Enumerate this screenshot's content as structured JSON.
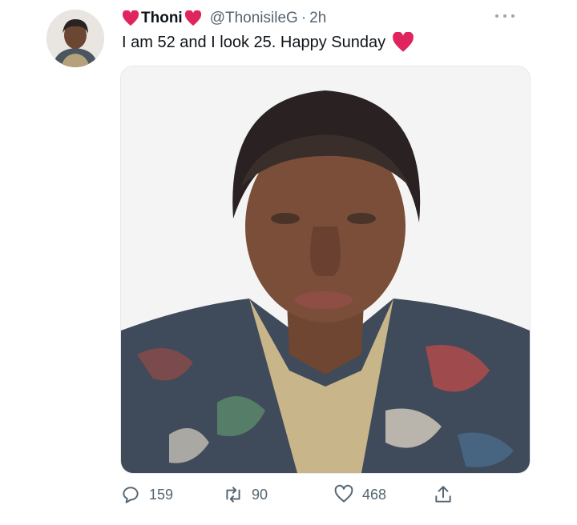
{
  "tweet": {
    "display_name": "Thoni",
    "handle": "@ThonisileG",
    "separator": "·",
    "time": "2h",
    "text": "I am 52 and I look 25. Happy Sunday"
  },
  "icons": {
    "name_left": "red-heart-icon",
    "name_right": "red-heart-icon",
    "text_end": "red-heart-icon",
    "more": "more-dots-icon",
    "reply": "reply-bubble-icon",
    "retweet": "retweet-icon",
    "like": "heart-outline-icon",
    "share": "share-upload-icon"
  },
  "counts": {
    "replies": "159",
    "retweets": "90",
    "likes": "468"
  },
  "colors": {
    "heart": "#e0245e",
    "meta": "#536471",
    "text": "#0f1419"
  }
}
